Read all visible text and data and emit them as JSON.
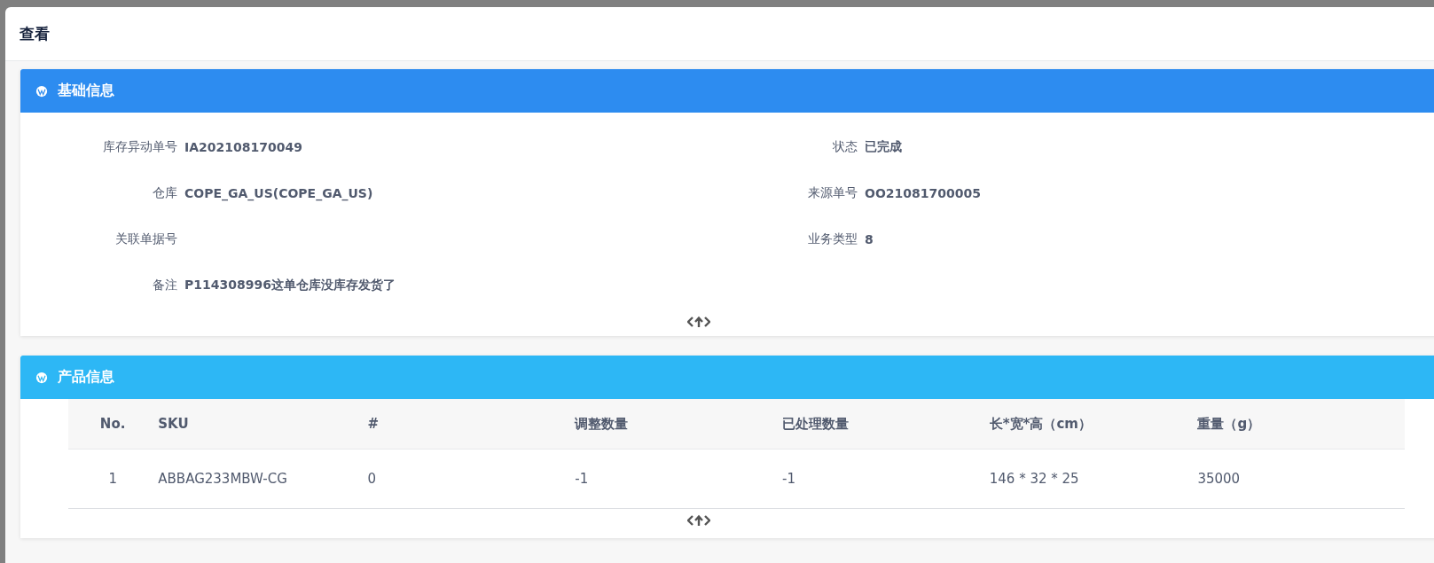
{
  "dialog": {
    "title": "查看"
  },
  "basic_info": {
    "title": "基础信息",
    "fields": [
      {
        "label": "库存异动单号",
        "value": "IA202108170049"
      },
      {
        "label": "状态",
        "value": "已完成"
      },
      {
        "label": "仓库",
        "value": "COPE_GA_US(COPE_GA_US)"
      },
      {
        "label": "来源单号",
        "value": "OO21081700005"
      },
      {
        "label": "关联单据号"
      },
      {
        "label": "业务类型",
        "value": "8"
      },
      {
        "label": "备注",
        "value": "P114308996这单仓库没库存发货了"
      }
    ]
  },
  "product_info": {
    "title": "产品信息",
    "table": {
      "columns": [
        "No.",
        "SKU",
        "#",
        "调整数量",
        "已处理数量",
        "长*宽*高（cm）",
        "重量（g）"
      ],
      "rows": [
        [
          "1",
          "ABBAG233MBW-CG",
          "0",
          "-1",
          "-1",
          "146 * 32 * 25",
          "35000"
        ]
      ]
    }
  }
}
